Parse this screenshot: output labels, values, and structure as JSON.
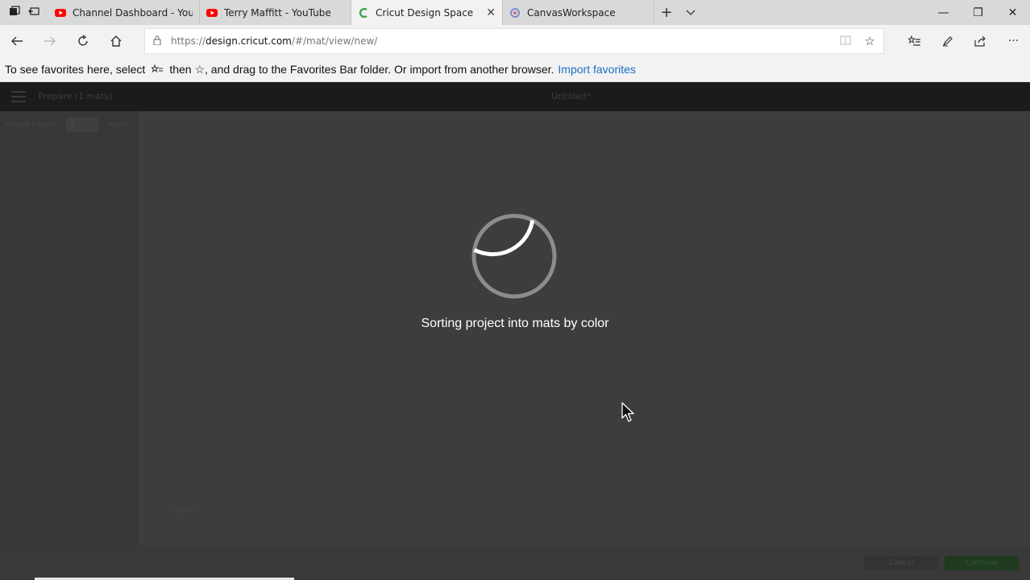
{
  "browser": {
    "tabs": [
      {
        "title": "Channel Dashboard - YouTu",
        "favicon": "youtube-icon"
      },
      {
        "title": "Terry Maffitt - YouTube",
        "favicon": "youtube-icon"
      },
      {
        "title": "Cricut Design Space",
        "favicon": "cricut-icon",
        "active": true
      },
      {
        "title": "CanvasWorkspace",
        "favicon": "canvasworkspace-icon"
      }
    ],
    "url_scheme": "https://",
    "url_host": "design.cricut.com",
    "url_path": "/#/mat/view/new/",
    "favorites_bar": {
      "text_prefix": "To see favorites here, select",
      "text_then": "then ☆, and drag to the Favorites Bar folder. Or import from another browser.",
      "import_link": "Import favorites"
    }
  },
  "app": {
    "prepare_label": "Prepare (1 mats)",
    "document_title": "Untitled*",
    "project_copies_label": "Project copies",
    "project_copies_value": "1",
    "apply_label": "Apply",
    "mirror_label": "Mirror",
    "cancel_label": "Cancel",
    "continue_label": "Continue"
  },
  "loading": {
    "message": "Sorting project into mats by color",
    "progress_fraction": 0.3
  },
  "colors": {
    "youtube_red": "#ff0000",
    "cricut_green": "#3ca64a",
    "link_blue": "#1a6fc2",
    "app_background": "#3c3c3c"
  }
}
